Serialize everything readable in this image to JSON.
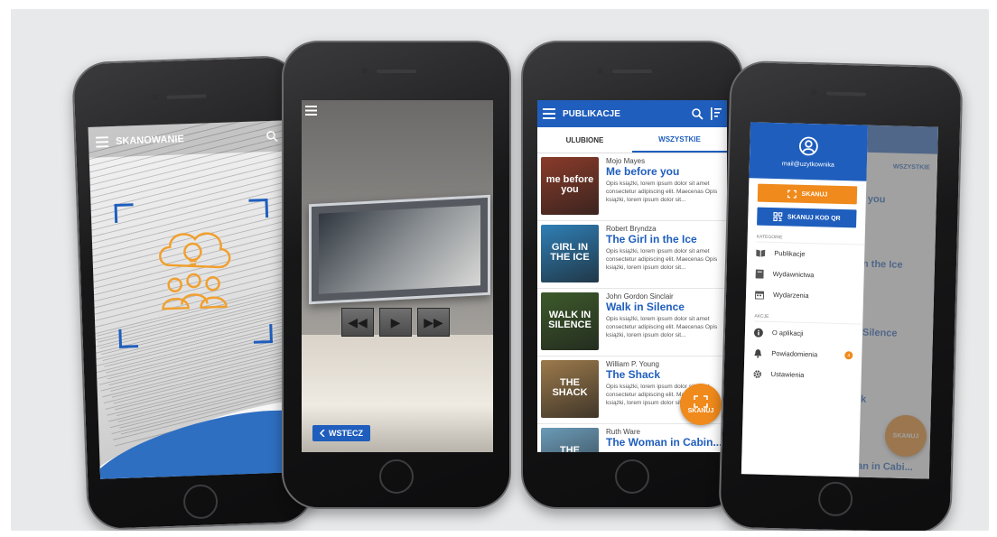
{
  "phone1": {
    "title": "SKANOWANIE",
    "icons": {
      "menu": "menu-icon",
      "search": "search-icon",
      "illustration": "idea-people-icon"
    }
  },
  "phone2": {
    "back_label": "WSTECZ",
    "media_controls": [
      "rewind",
      "play",
      "fast-forward"
    ]
  },
  "phone3": {
    "title": "PUBLIKACJE",
    "tabs": [
      {
        "label": "ULUBIONE",
        "active": false
      },
      {
        "label": "WSZYSTKIE",
        "active": true
      }
    ],
    "fab_label": "SKANUJ",
    "publications": [
      {
        "author": "Mojo Mayes",
        "title": "Me before you",
        "cover_text": "me before you",
        "cover_color": "#8a3b2a",
        "desc": "Opis książki, lorem ipsum dolor sit amet consectetur adipiscing elit. Maecenas Opis książki, lorem ipsum dolor sit..."
      },
      {
        "author": "Robert Bryndza",
        "title": "The Girl in the Ice",
        "cover_text": "GIRL IN THE ICE",
        "cover_color": "#2f7fb6",
        "desc": "Opis książki, lorem ipsum dolor sit amet consectetur adipiscing elit. Maecenas Opis książki, lorem ipsum dolor sit..."
      },
      {
        "author": "John Gordon Sinclair",
        "title": "Walk in Silence",
        "cover_text": "WALK IN SILENCE",
        "cover_color": "#3d5a2b",
        "desc": "Opis książki, lorem ipsum dolor sit amet consectetur adipiscing elit. Maecenas Opis książki, lorem ipsum dolor sit..."
      },
      {
        "author": "William P. Young",
        "title": "The Shack",
        "cover_text": "THE SHACK",
        "cover_color": "#9c7a4c",
        "desc": "Opis książki, lorem ipsum dolor sit amet consectetur adipiscing elit. Maecenas Opis książki, lorem ipsum dolor sit..."
      },
      {
        "author": "Ruth Ware",
        "title": "The Woman in Cabin...",
        "cover_text": "THE WOMAN",
        "cover_color": "#6b9bb8",
        "desc": ""
      }
    ]
  },
  "phone4": {
    "email": "mail@uzytkownika",
    "scan_button": "SKANUJ",
    "scan_qr_button": "SKANUJ KOD QR",
    "section_categories": "KATEGORIE",
    "section_actions": "AKCJE",
    "categories": [
      {
        "label": "Publikacje",
        "icon": "book-open-icon"
      },
      {
        "label": "Wydawnictwa",
        "icon": "book-icon"
      },
      {
        "label": "Wydarzenia",
        "icon": "calendar-icon"
      }
    ],
    "actions": [
      {
        "label": "O aplikacji",
        "icon": "info-icon",
        "badge": ""
      },
      {
        "label": "Powiadomienia",
        "icon": "bell-icon",
        "badge": "4"
      },
      {
        "label": "Ustawienia",
        "icon": "gear-icon",
        "badge": ""
      }
    ],
    "background_tab": "WSZYSTKIE",
    "background_fab": "SKANUJ",
    "background_titles": [
      "you",
      "n the Ice",
      "Silence",
      "k",
      "an in Cabi..."
    ]
  },
  "colors": {
    "primary": "#1f5ebd",
    "accent": "#f08a1c",
    "background": "#e7e9ea"
  }
}
